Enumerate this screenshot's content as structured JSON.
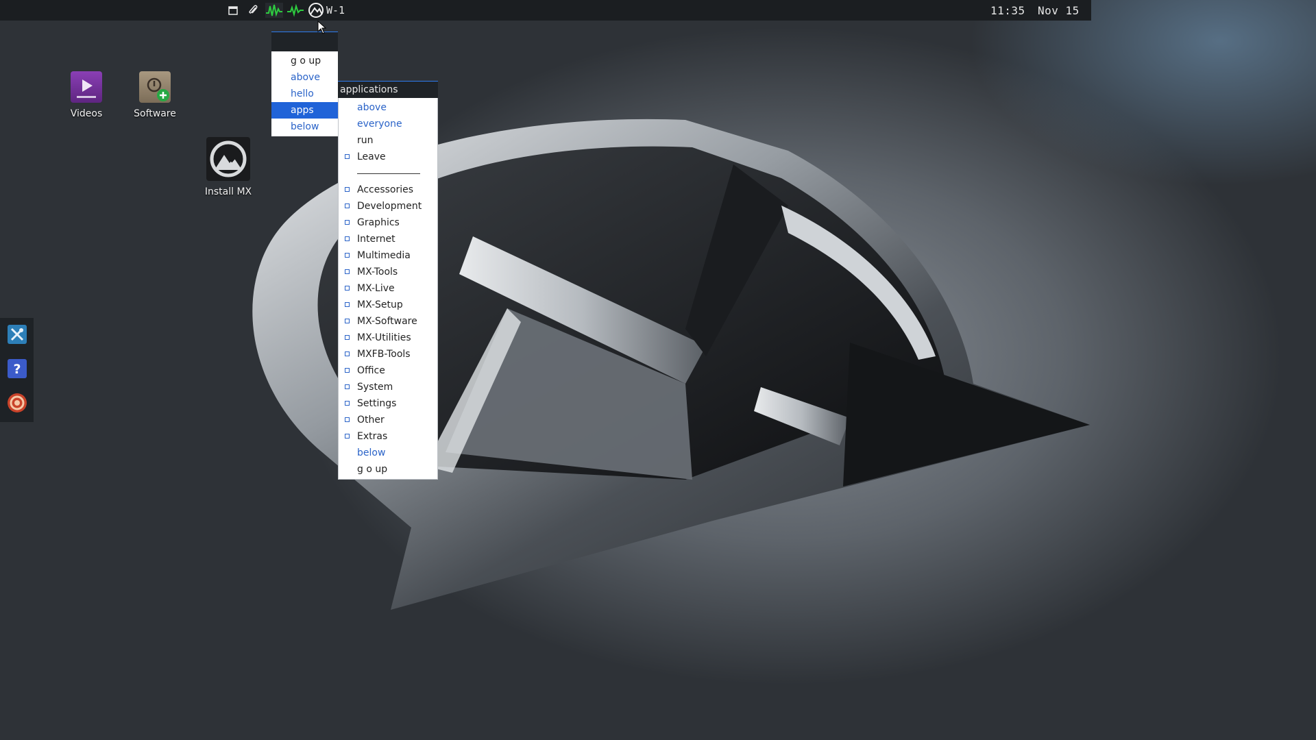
{
  "panel": {
    "workspace_label": "W-1",
    "clock": "11:35",
    "date": "Nov 15",
    "tray_icons": [
      "window-icon",
      "paperclip-icon",
      "cpu-monitor-icon",
      "network-monitor-icon",
      "mx-logo-icon"
    ]
  },
  "desktop": {
    "icons": [
      {
        "label": "Videos",
        "icon": "video-folder-icon"
      },
      {
        "label": "Software",
        "icon": "software-installer-icon"
      },
      {
        "label": "Install MX",
        "icon": "mx-install-icon"
      }
    ]
  },
  "dock": {
    "items": [
      "mx-tools-icon",
      "help-icon",
      "bug-report-icon"
    ]
  },
  "root_menu": {
    "items": [
      {
        "label": "g o up"
      },
      {
        "label": "above"
      },
      {
        "label": "hello"
      },
      {
        "label": "apps"
      },
      {
        "label": "below"
      }
    ]
  },
  "apps_menu": {
    "title": "applications",
    "top_items": [
      {
        "label": "above"
      },
      {
        "label": "everyone"
      },
      {
        "label": "run"
      },
      {
        "label": "Leave"
      }
    ],
    "categories": [
      {
        "label": "Accessories"
      },
      {
        "label": "Development"
      },
      {
        "label": "Graphics"
      },
      {
        "label": "Internet"
      },
      {
        "label": "Multimedia"
      },
      {
        "label": "MX-Tools"
      },
      {
        "label": "MX-Live"
      },
      {
        "label": "MX-Setup"
      },
      {
        "label": "MX-Software"
      },
      {
        "label": "MX-Utilities"
      },
      {
        "label": "MXFB-Tools"
      },
      {
        "label": "Office"
      },
      {
        "label": "System"
      },
      {
        "label": "Settings"
      },
      {
        "label": "Other"
      },
      {
        "label": "Extras"
      }
    ],
    "bottom_items": [
      {
        "label": "below"
      },
      {
        "label": "g o up"
      }
    ]
  },
  "colors": {
    "accent": "#2063d8",
    "link": "#2a63c8",
    "panel": "#1b1e21"
  }
}
